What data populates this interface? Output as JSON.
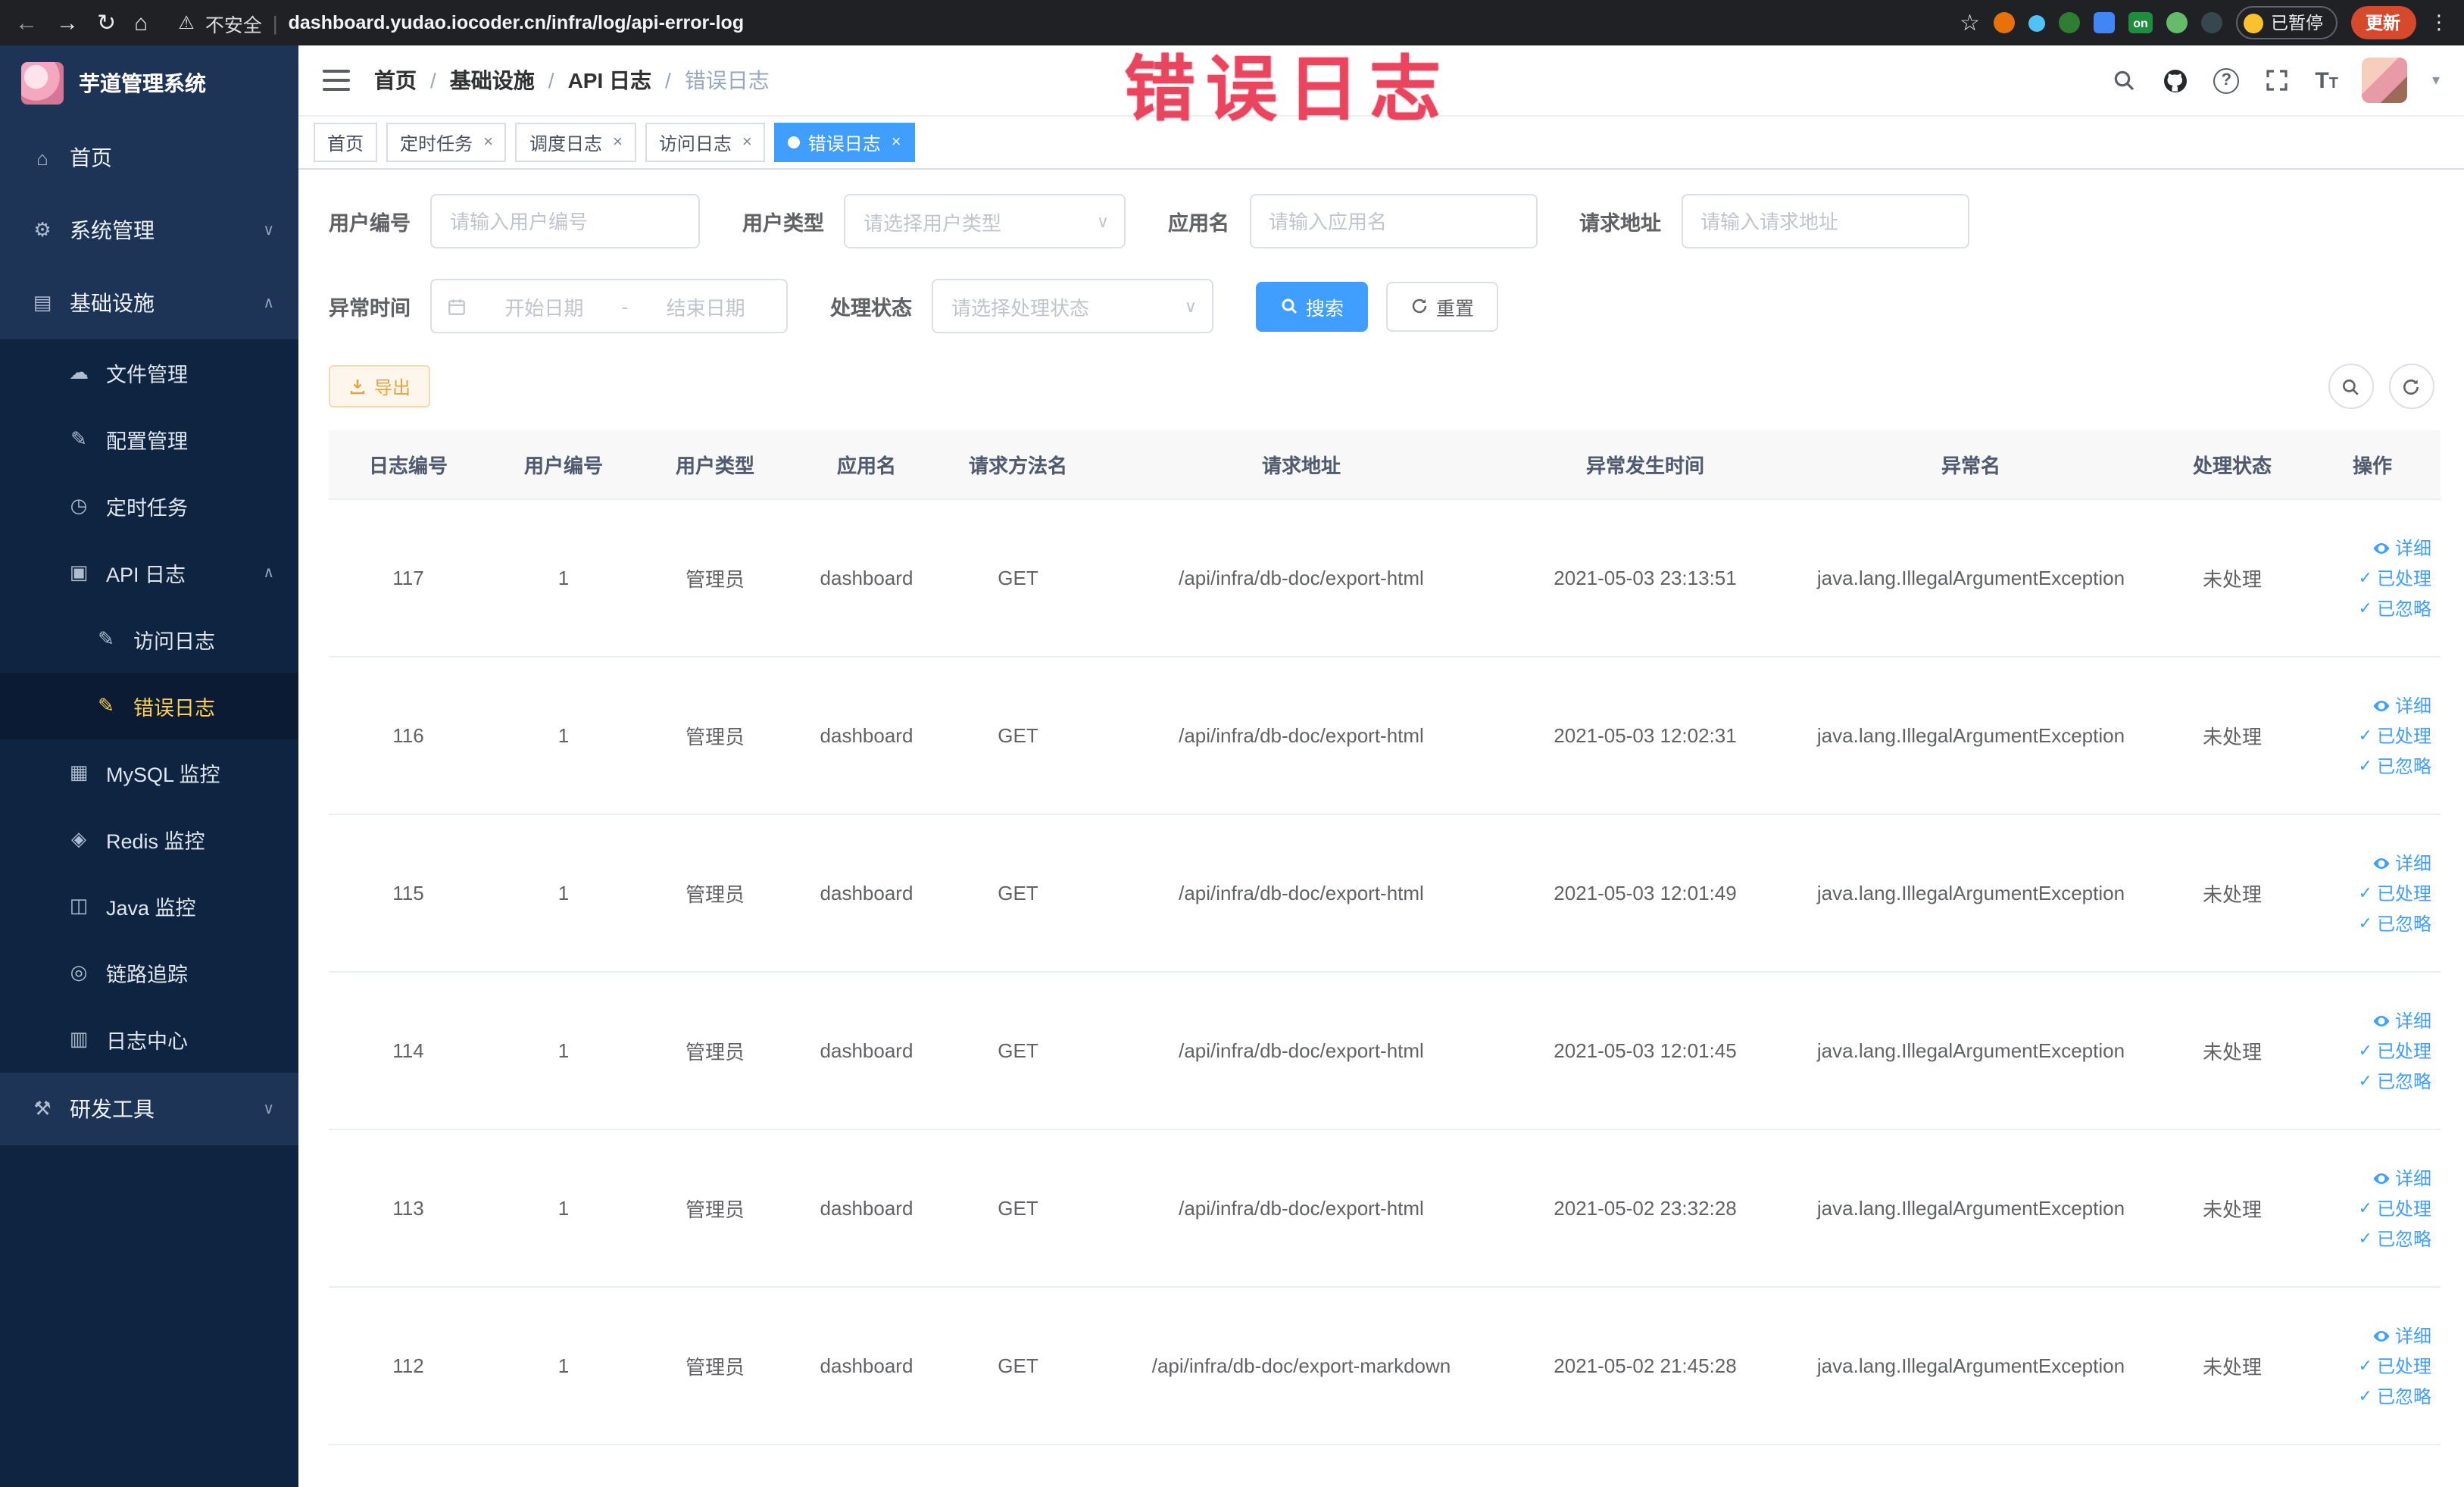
{
  "browser": {
    "security_label": "不安全",
    "url": "dashboard.yudao.iocoder.cn/infra/log/api-error-log",
    "on_badge": "on",
    "paused_badge": "已暂停",
    "update_button": "更新"
  },
  "overlay": {
    "stamp": "错误日志"
  },
  "sidebar": {
    "logo_title": "芋道管理系统",
    "items": [
      {
        "label": "首页",
        "level": 1,
        "icon": "home-icon"
      },
      {
        "label": "系统管理",
        "level": 1,
        "icon": "gear-icon",
        "arrow": "down"
      },
      {
        "label": "基础设施",
        "level": 1,
        "icon": "infra-icon",
        "arrow": "up"
      },
      {
        "label": "文件管理",
        "level": 2,
        "icon": "file-icon"
      },
      {
        "label": "配置管理",
        "level": 2,
        "icon": "config-icon"
      },
      {
        "label": "定时任务",
        "level": 2,
        "icon": "job-icon"
      },
      {
        "label": "API 日志",
        "level": 2,
        "icon": "api-log-icon",
        "arrow": "up"
      },
      {
        "label": "访问日志",
        "level": 3,
        "icon": "edit-icon"
      },
      {
        "label": "错误日志",
        "level": 3,
        "icon": "edit-icon",
        "active": true
      },
      {
        "label": "MySQL 监控",
        "level": 2,
        "icon": "mysql-icon"
      },
      {
        "label": "Redis 监控",
        "level": 2,
        "icon": "redis-icon"
      },
      {
        "label": "Java 监控",
        "level": 2,
        "icon": "java-icon"
      },
      {
        "label": "链路追踪",
        "level": 2,
        "icon": "trace-icon"
      },
      {
        "label": "日志中心",
        "level": 2,
        "icon": "log-center-icon"
      },
      {
        "label": "研发工具",
        "level": 1,
        "icon": "tools-icon",
        "arrow": "down"
      }
    ]
  },
  "header": {
    "breadcrumb": [
      "首页",
      "基础设施",
      "API 日志",
      "错误日志"
    ],
    "separator": "/"
  },
  "tabs": [
    {
      "label": "首页",
      "closable": false,
      "active": false
    },
    {
      "label": "定时任务",
      "closable": true,
      "active": false
    },
    {
      "label": "调度日志",
      "closable": true,
      "active": false
    },
    {
      "label": "访问日志",
      "closable": true,
      "active": false
    },
    {
      "label": "错误日志",
      "closable": true,
      "active": true
    }
  ],
  "filters": {
    "user_id": {
      "label": "用户编号",
      "placeholder": "请输入用户编号"
    },
    "user_type": {
      "label": "用户类型",
      "placeholder": "请选择用户类型"
    },
    "app_name": {
      "label": "应用名",
      "placeholder": "请输入应用名"
    },
    "request_url": {
      "label": "请求地址",
      "placeholder": "请输入请求地址"
    },
    "exception_time": {
      "label": "异常时间",
      "start_placeholder": "开始日期",
      "separator": "-",
      "end_placeholder": "结束日期"
    },
    "process_status": {
      "label": "处理状态",
      "placeholder": "请选择处理状态"
    },
    "search_button": "搜索",
    "reset_button": "重置"
  },
  "toolbar": {
    "export_button": "导出"
  },
  "table": {
    "columns": [
      "日志编号",
      "用户编号",
      "用户类型",
      "应用名",
      "请求方法名",
      "请求地址",
      "异常发生时间",
      "异常名",
      "处理状态",
      "操作"
    ],
    "row_actions": [
      "详细",
      "已处理",
      "已忽略"
    ],
    "rows": [
      {
        "id": "117",
        "user_id": "1",
        "user_type": "管理员",
        "app": "dashboard",
        "method": "GET",
        "url": "/api/infra/db-doc/export-html",
        "time": "2021-05-03 23:13:51",
        "exception": "java.lang.IllegalArgumentException",
        "status": "未处理"
      },
      {
        "id": "116",
        "user_id": "1",
        "user_type": "管理员",
        "app": "dashboard",
        "method": "GET",
        "url": "/api/infra/db-doc/export-html",
        "time": "2021-05-03 12:02:31",
        "exception": "java.lang.IllegalArgumentException",
        "status": "未处理"
      },
      {
        "id": "115",
        "user_id": "1",
        "user_type": "管理员",
        "app": "dashboard",
        "method": "GET",
        "url": "/api/infra/db-doc/export-html",
        "time": "2021-05-03 12:01:49",
        "exception": "java.lang.IllegalArgumentException",
        "status": "未处理"
      },
      {
        "id": "114",
        "user_id": "1",
        "user_type": "管理员",
        "app": "dashboard",
        "method": "GET",
        "url": "/api/infra/db-doc/export-html",
        "time": "2021-05-03 12:01:45",
        "exception": "java.lang.IllegalArgumentException",
        "status": "未处理"
      },
      {
        "id": "113",
        "user_id": "1",
        "user_type": "管理员",
        "app": "dashboard",
        "method": "GET",
        "url": "/api/infra/db-doc/export-html",
        "time": "2021-05-02 23:32:28",
        "exception": "java.lang.IllegalArgumentException",
        "status": "未处理"
      },
      {
        "id": "112",
        "user_id": "1",
        "user_type": "管理员",
        "app": "dashboard",
        "method": "GET",
        "url": "/api/infra/db-doc/export-markdown",
        "time": "2021-05-02 21:45:28",
        "exception": "java.lang.IllegalArgumentException",
        "status": "未处理"
      }
    ]
  }
}
